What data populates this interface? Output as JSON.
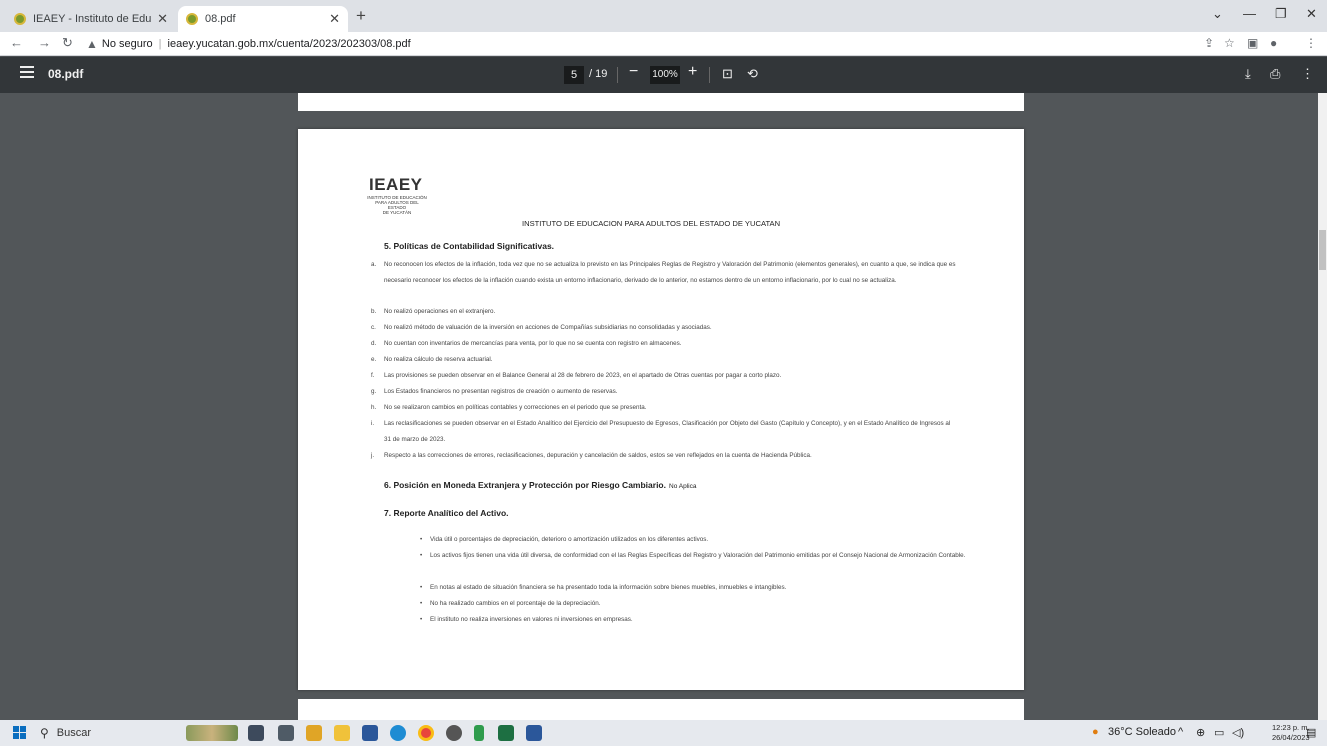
{
  "browser": {
    "tabs": [
      {
        "title": "IEAEY - Instituto de Educación pa",
        "active": false
      },
      {
        "title": "08.pdf",
        "active": true
      }
    ],
    "address": {
      "security_label": "No seguro",
      "url": "ieaey.yucatan.gob.mx/cuenta/2023/202303/08.pdf"
    }
  },
  "pdf_toolbar": {
    "file_name": "08.pdf",
    "current_page": "5",
    "total_pages": "/ 19",
    "zoom": "100%"
  },
  "document": {
    "logo_text": "IEAEY",
    "logo_subtext": [
      "INSTITUTO DE EDUCACIÓN",
      "PARA ADULTOS DEL ESTADO",
      "DE YUCATÁN"
    ],
    "header": "INSTITUTO DE EDUCACION PARA ADULTOS DEL ESTADO DE YUCATAN",
    "section5": {
      "title": "5.   Políticas de Contabilidad Significativas.",
      "items": [
        {
          "marker": "a.",
          "text": "No reconocen los efectos de la inflación, toda vez que no se actualiza lo previsto en las Principales Reglas de Registro y Valoración del Patrimonio (elementos generales), en cuanto a que, se indica que es necesario reconocer los efectos de la inflación cuando exista un entorno inflacionario, derivado de lo anterior, no estamos dentro de un entorno inflacionario, por lo cual no se actualiza."
        },
        {
          "marker": "b.",
          "text": "No realizó operaciones en el extranjero."
        },
        {
          "marker": "c.",
          "text": "No realizó método de valuación de la inversión en acciones de Compañías subsidiarias no consolidadas y asociadas."
        },
        {
          "marker": "d.",
          "text": "No cuentan con inventarios de mercancías para venta, por lo que no se cuenta con registro en almacenes."
        },
        {
          "marker": "e.",
          "text": "No realiza cálculo de reserva actuarial."
        },
        {
          "marker": "f.",
          "text": "Las provisiones se pueden observar en el Balance General al 28 de febrero de 2023, en el apartado de Otras cuentas por pagar a corto plazo."
        },
        {
          "marker": "g.",
          "text": "Los Estados financieros no presentan registros de creación o aumento de reservas."
        },
        {
          "marker": "h.",
          "text": "No se realizaron cambios en políticas contables y correcciones en el periodo que se presenta."
        },
        {
          "marker": "i.",
          "text": "Las reclasificaciones se pueden observar en el Estado Analítico del Ejercicio del Presupuesto de Egresos, Clasificación por Objeto del Gasto (Capítulo y Concepto), y en el Estado Analítico de Ingresos al 31 de marzo de 2023."
        },
        {
          "marker": "j.",
          "text": "Respecto a las correcciones de errores, reclasificaciones, depuración y cancelación de saldos, estos se ven reflejados en la cuenta de Hacienda Pública."
        }
      ]
    },
    "section6": {
      "title": "6.   Posición en Moneda Extranjera y Protección por Riesgo Cambiario.",
      "note": "No Aplica"
    },
    "section7": {
      "title": "7.   Reporte Analítico del Activo.",
      "bullets": [
        "Vida útil o porcentajes de depreciación, deterioro o amortización utilizados en los diferentes activos.",
        "Los activos fijos tienen una vida útil diversa, de conformidad con el las Reglas Específicas del Registro y Valoración del Patrimonio emitidas por el Consejo Nacional de Armonización Contable.",
        "En notas al estado de situación financiera se ha presentado toda la información sobre bienes muebles, inmuebles e intangibles.",
        "No ha realizado cambios en el porcentaje de la depreciación.",
        "El instituto no realiza inversiones en valores ni inversiones en empresas."
      ]
    }
  },
  "taskbar": {
    "search_placeholder": "Buscar",
    "weather": "36°C  Soleado",
    "time": "12:23 p. m.",
    "date": "26/04/2023"
  }
}
